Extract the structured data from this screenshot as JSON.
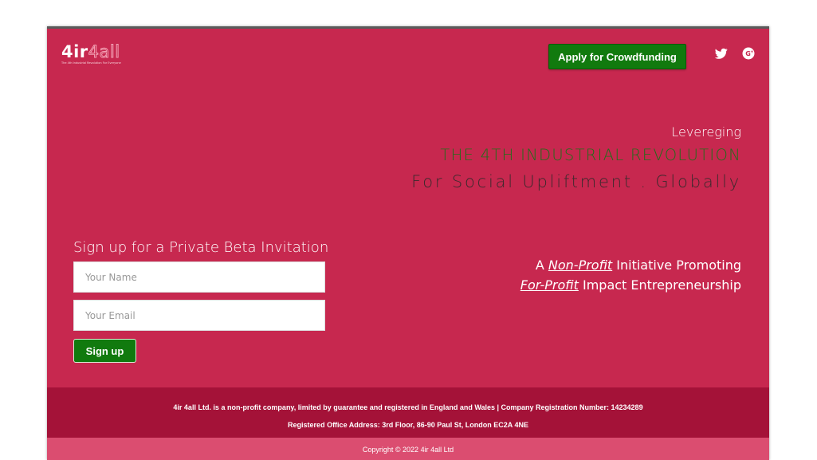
{
  "header": {
    "logo": {
      "bold": "4ir",
      "outline": "4all",
      "tagline": "The 4th Industrial Revolution For Everyone"
    },
    "apply_button": "Apply for Crowdfunding",
    "social": [
      {
        "icon": "twitter-icon",
        "color": "#ffffff"
      },
      {
        "icon": "google-plus-icon",
        "color": "#ffffff"
      }
    ]
  },
  "hero": {
    "line1": "Levereging",
    "line2": "THE 4TH INDUSTRIAL REVOLUTION",
    "line3": "For Social Upliftment . Globally"
  },
  "tagline": {
    "prefix": "A ",
    "nonprofit": "Non-Profit",
    "middle": " Initiative Promoting",
    "forprofit": "For-Profit",
    "suffix": " Impact Entrepreneurship"
  },
  "signup": {
    "title": "Sign up for a Private Beta Invitation",
    "name_placeholder": "Your Name",
    "email_placeholder": "Your Email",
    "button": "Sign up"
  },
  "footer": {
    "line1": "4ir 4all Ltd. is a non-profit company, limited by guarantee and registered in England and Wales | Company Registration Number: 14234289",
    "line2": "Registered Office Address: 3rd Floor, 86-90 Paul St, London EC2A 4NE",
    "copyright": "Copyright © 2022 4ir 4all Ltd"
  },
  "colors": {
    "background": "#c7284f",
    "footer_dark": "#a41238",
    "footer_light": "#db4d70",
    "button_green": "#117a0e",
    "hero_green": "#1f6f1a"
  }
}
